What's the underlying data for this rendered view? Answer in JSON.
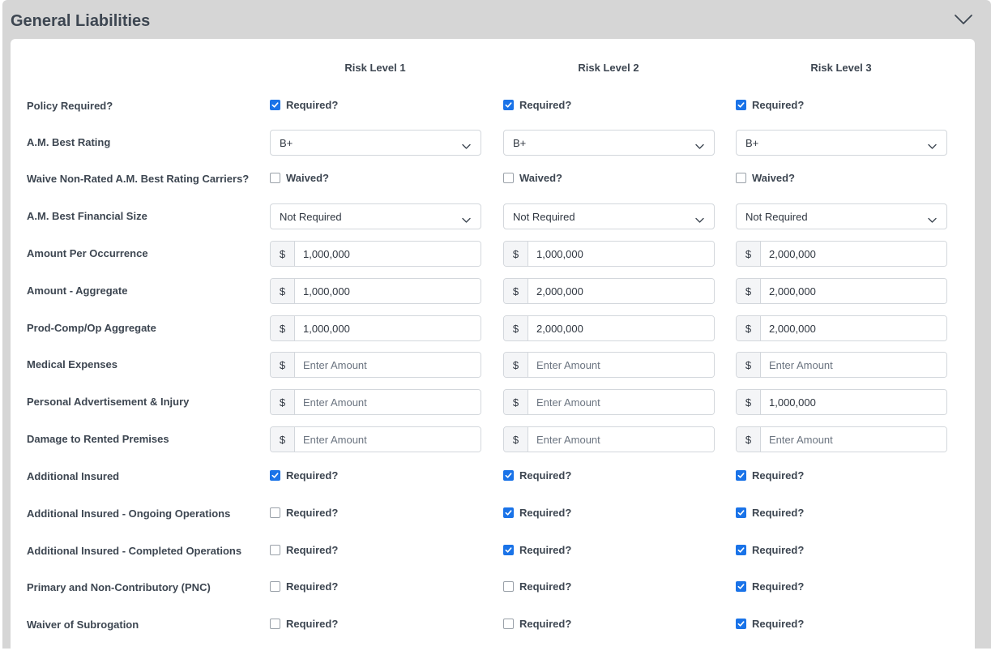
{
  "section": {
    "title": "General Liabilities"
  },
  "columns": [
    "Risk Level 1",
    "Risk Level 2",
    "Risk Level 3"
  ],
  "labels": {
    "policy_required": "Policy Required?",
    "am_best_rating": "A.M. Best Rating",
    "waive_nonrated": "Waive Non-Rated A.M. Best Rating Carriers?",
    "am_best_financial_size": "A.M. Best Financial Size",
    "amount_per_occurrence": "Amount Per Occurrence",
    "amount_aggregate": "Amount - Aggregate",
    "prod_comp_op_aggregate": "Prod-Comp/Op Aggregate",
    "medical_expenses": "Medical Expenses",
    "personal_advertisement_injury": "Personal Advertisement & Injury",
    "damage_rented_premises": "Damage to Rented Premises",
    "additional_insured": "Additional Insured",
    "ai_ongoing_operations": "Additional Insured - Ongoing Operations",
    "ai_completed_operations": "Additional Insured - Completed Operations",
    "primary_noncontributory": "Primary and Non-Contributory (PNC)",
    "waiver_subrogation": "Waiver of Subrogation"
  },
  "text": {
    "required": "Required?",
    "waived": "Waived?",
    "currency_symbol": "$",
    "amount_placeholder": "Enter Amount"
  },
  "values": {
    "policy_required": [
      true,
      true,
      true
    ],
    "am_best_rating": [
      "B+",
      "B+",
      "B+"
    ],
    "waive_nonrated": [
      false,
      false,
      false
    ],
    "am_best_financial_size": [
      "Not Required",
      "Not Required",
      "Not Required"
    ],
    "amount_per_occurrence": [
      "1,000,000",
      "1,000,000",
      "2,000,000"
    ],
    "amount_aggregate": [
      "1,000,000",
      "2,000,000",
      "2,000,000"
    ],
    "prod_comp_op_aggregate": [
      "1,000,000",
      "2,000,000",
      "2,000,000"
    ],
    "medical_expenses": [
      "",
      "",
      ""
    ],
    "personal_advertisement_injury": [
      "",
      "",
      "1,000,000"
    ],
    "damage_rented_premises": [
      "",
      "",
      ""
    ],
    "additional_insured": [
      true,
      true,
      true
    ],
    "ai_ongoing_operations": [
      false,
      true,
      true
    ],
    "ai_completed_operations": [
      false,
      true,
      true
    ],
    "primary_noncontributory": [
      false,
      false,
      true
    ],
    "waiver_subrogation": [
      false,
      false,
      true
    ]
  },
  "colors": {
    "checkbox_checked": "#1a73e8",
    "panel_background": "#d6d6d6"
  },
  "icons": {
    "collapse": "chevron-down-icon",
    "select_caret": "chevron-down-icon",
    "checkbox_check": "checkmark-icon"
  }
}
